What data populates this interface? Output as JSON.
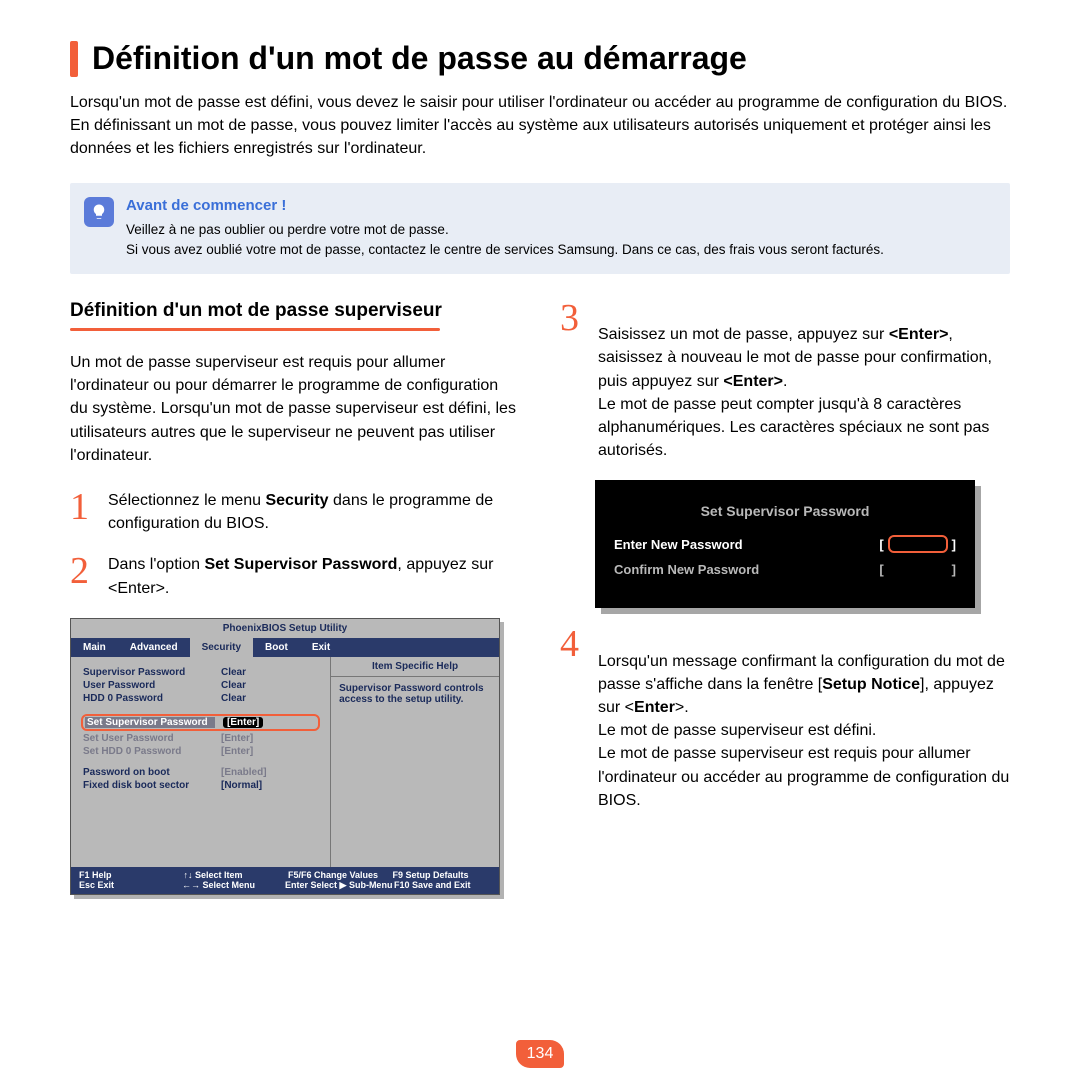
{
  "page": {
    "title": "Définition d'un mot de passe au démarrage",
    "intro": "Lorsqu'un mot de passe est défini, vous devez le saisir pour utiliser l'ordinateur ou accéder au programme de configuration du BIOS.\nEn définissant un mot de passe, vous pouvez limiter l'accès au système aux utilisateurs autorisés uniquement et protéger ainsi les données et les fichiers enregistrés sur l'ordinateur.",
    "number": "134"
  },
  "note": {
    "title": "Avant de commencer !",
    "line1": "Veillez à ne pas oublier ou perdre votre mot de passe.",
    "line2": "Si vous avez oublié votre mot de passe, contactez le centre de services Samsung. Dans ce cas, des frais vous seront facturés."
  },
  "left": {
    "heading": "Définition d'un mot de passe superviseur",
    "para": "Un mot de passe superviseur est requis pour allumer l'ordinateur ou pour démarrer le programme de configuration du système. Lorsqu'un mot de passe superviseur est défini, les utilisateurs autres que le superviseur ne peuvent pas utiliser l'ordinateur.",
    "step1_pre": "Sélectionnez le menu ",
    "step1_bold": "Security",
    "step1_post": " dans le programme de configuration du BIOS.",
    "step2_pre": "Dans l'option ",
    "step2_bold": "Set Supervisor Password",
    "step2_post": ", appuyez sur <Enter>."
  },
  "right": {
    "step3_a": "Saisissez un mot de passe, appuyez sur ",
    "step3_b": "<Enter>",
    "step3_c": ", saisissez à nouveau le mot de passe pour confirmation, puis appuyez sur ",
    "step3_d": "<Enter>",
    "step3_e": ".\nLe mot de passe peut compter jusqu'à 8 caractères alphanumériques. Les caractères spéciaux ne sont pas autorisés.",
    "step4_a": "Lorsqu'un message confirmant la configuration du mot de passe s'affiche dans la fenêtre [",
    "step4_b": "Setup Notice",
    "step4_c": "], appuyez sur <",
    "step4_d": "Enter",
    "step4_e": ">.\nLe mot de passe superviseur est défini.\nLe mot de passe superviseur est requis pour allumer l'ordinateur ou accéder au programme de configuration du BIOS."
  },
  "bios": {
    "title": "PhoenixBIOS Setup Utility",
    "tabs": [
      "Main",
      "Advanced",
      "Security",
      "Boot",
      "Exit"
    ],
    "active_tab": "Security",
    "help_head": "Item Specific Help",
    "help_body": "Supervisor Password controls access to the setup utility.",
    "rows": [
      {
        "k": "Supervisor Password",
        "v": "Clear"
      },
      {
        "k": "User Password",
        "v": "Clear"
      },
      {
        "k": "HDD 0 Password",
        "v": "Clear"
      }
    ],
    "highlight": {
      "k": "Set Supervisor Password",
      "v": "[Enter]"
    },
    "dimrows": [
      {
        "k": "Set User Password",
        "v": "[Enter]"
      },
      {
        "k": "Set HDD 0 Password",
        "v": "[Enter]"
      }
    ],
    "rows2": [
      {
        "k": "Password on boot",
        "v": "[Enabled]"
      },
      {
        "k": "Fixed disk boot sector",
        "v": "[Normal]"
      }
    ],
    "foot": {
      "r1": [
        "F1   Help",
        "↑↓  Select Item",
        "F5/F6  Change Values",
        "F9    Setup Defaults"
      ],
      "r2": [
        "Esc  Exit",
        "←→  Select Menu",
        "Enter  Select ▶ Sub-Menu",
        "F10   Save and Exit"
      ]
    }
  },
  "dialog": {
    "title": "Set Supervisor Password",
    "row1": "Enter New Password",
    "row2": "Confirm New Password"
  }
}
